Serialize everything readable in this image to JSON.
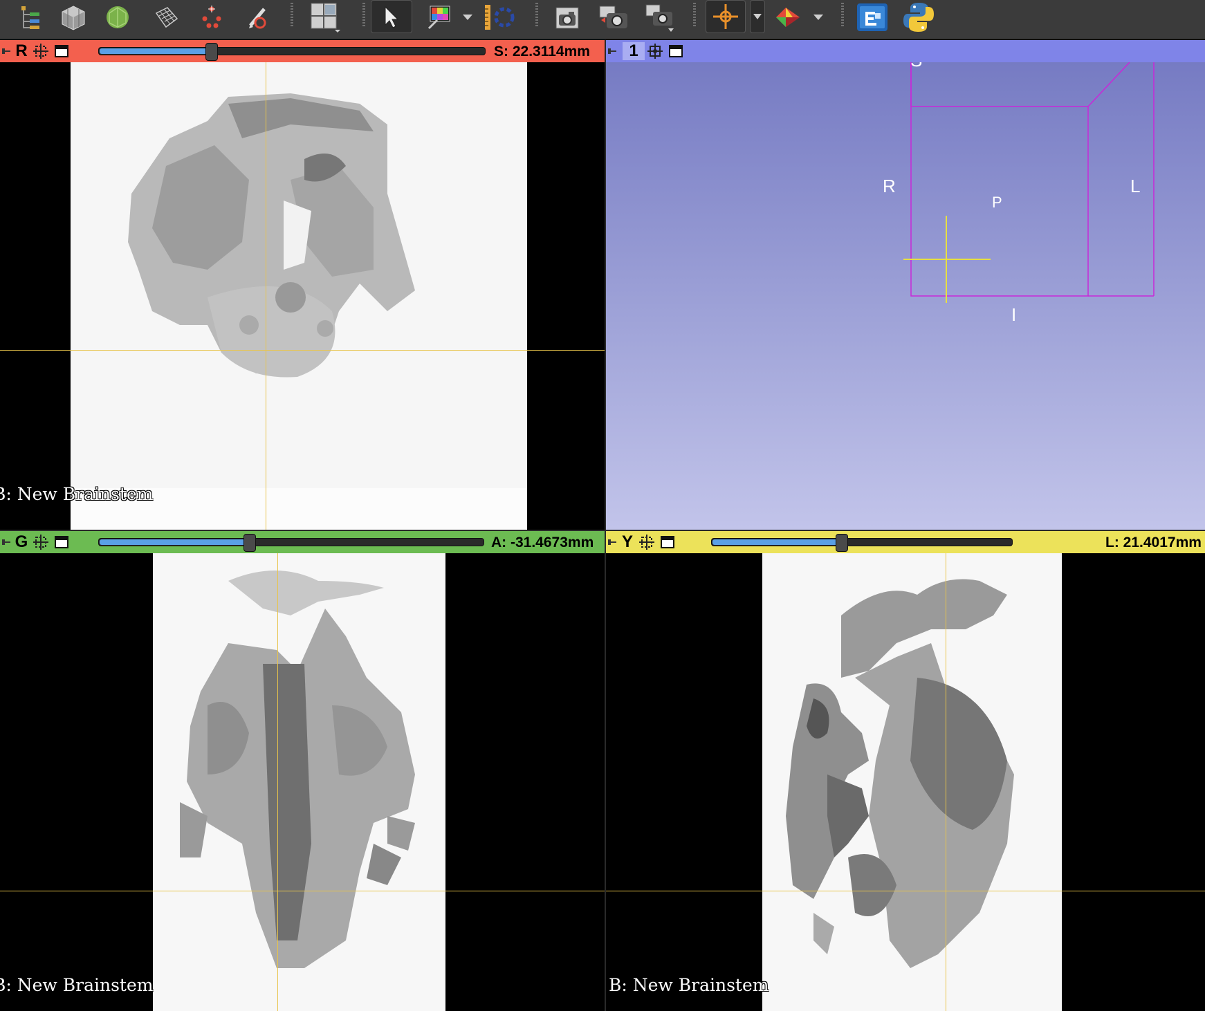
{
  "toolbar": {
    "icons": [
      "data-tree-icon",
      "volume-cube-icon",
      "model-sphere-icon",
      "grid-mesh-icon",
      "markups-dots-icon",
      "pencil-segment-icon",
      "layout-icon",
      "mouse-pointer-icon",
      "color-window-level-icon",
      "ruler-icon",
      "transform-icon",
      "screenshot-camera-icon",
      "multi-camera-icon",
      "view-settings-icon",
      "crosshair-icon",
      "slicer-logo-icon",
      "extension-manager-icon",
      "python-icon"
    ]
  },
  "views": {
    "red": {
      "letter": "R",
      "offset": "S: 22.3114mm",
      "slider_fraction": 0.29,
      "volume_label": "B: New Brainstem",
      "color": "#f3604e"
    },
    "threed": {
      "label": "1",
      "color": "#7f84e8",
      "orientation": {
        "superior": "S",
        "right": "R",
        "posterior": "P",
        "left": "L",
        "inferior": "I"
      }
    },
    "green": {
      "letter": "G",
      "offset": "A: -31.4673mm",
      "slider_fraction": 0.39,
      "volume_label": "B: New Brainstem",
      "color": "#6cbb52"
    },
    "yellow": {
      "letter": "Y",
      "offset": "L: 21.4017mm",
      "slider_fraction": 0.43,
      "volume_label": "B: New Brainstem",
      "color": "#ece25a"
    }
  }
}
